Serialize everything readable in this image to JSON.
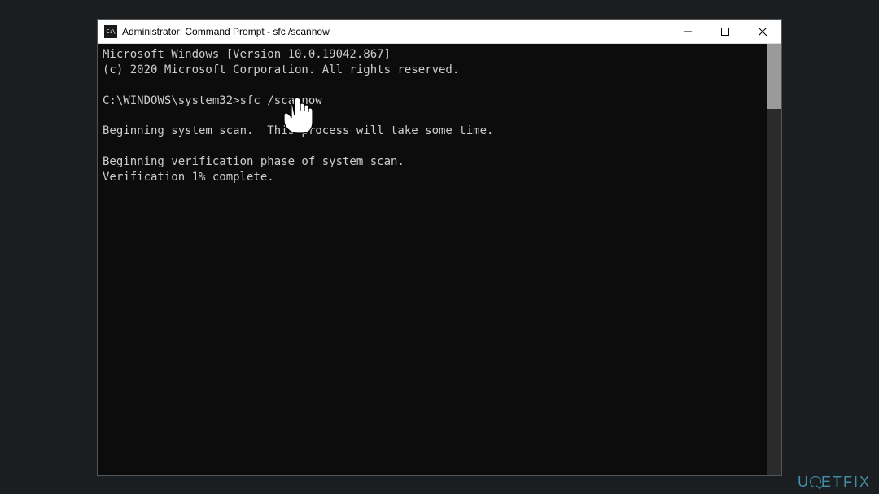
{
  "window": {
    "title": "Administrator: Command Prompt - sfc  /scannow",
    "icon_label": "C:\\"
  },
  "console": {
    "lines": [
      "Microsoft Windows [Version 10.0.19042.867]",
      "(c) 2020 Microsoft Corporation. All rights reserved.",
      "",
      "C:\\WINDOWS\\system32>sfc /scannow",
      "",
      "Beginning system scan.  This process will take some time.",
      "",
      "Beginning verification phase of system scan.",
      "Verification 1% complete."
    ]
  },
  "watermark": {
    "text_pre": "U",
    "text_post": "ETFIX"
  }
}
